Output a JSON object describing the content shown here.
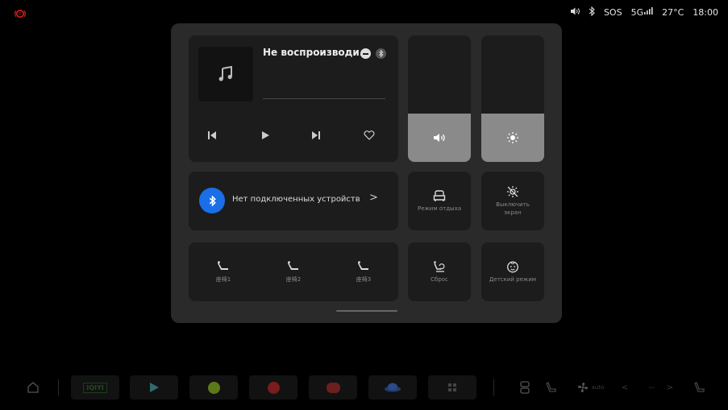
{
  "status_bar": {
    "alert_icon": "parking-brake-icon",
    "volume_icon": "speaker-icon",
    "bluetooth_icon": "bluetooth-icon",
    "sos": "SOS",
    "network": "5G",
    "signal_icon": "signal-bars-icon",
    "temperature": "27°C",
    "time": "18:00",
    "alert_color": "#d61f1f"
  },
  "media": {
    "title": "Не воспроизводи..",
    "album_icon": "music-note-icon",
    "controls": [
      "previous-icon",
      "play-icon",
      "next-icon",
      "heart-icon"
    ]
  },
  "sliders": {
    "volume": {
      "icon": "speaker-icon",
      "level": 0.38
    },
    "brightness": {
      "icon": "sun-icon",
      "level": 0.38
    }
  },
  "bluetooth": {
    "label": "Нет подключенных устройств",
    "arrow": ">",
    "accent": "#1a6fe8"
  },
  "tiles": {
    "rest_mode": "Режим отдыха",
    "screen_off": "Выключить экран",
    "reset": "Сброс",
    "kids_mode": "Детский режим"
  },
  "seats": [
    "座椅1",
    "座椅2",
    "座椅3"
  ],
  "dock": {
    "home_icon": "home-icon",
    "apps": [
      "iqiyi-app",
      "play-app",
      "green-app",
      "red-app",
      "music-app",
      "blue-app",
      "grid-app"
    ],
    "iqiyi_label": "IQIYI",
    "fan_label": "auto",
    "temp_left": "<",
    "temp_value": "--",
    "temp_right": ">"
  }
}
